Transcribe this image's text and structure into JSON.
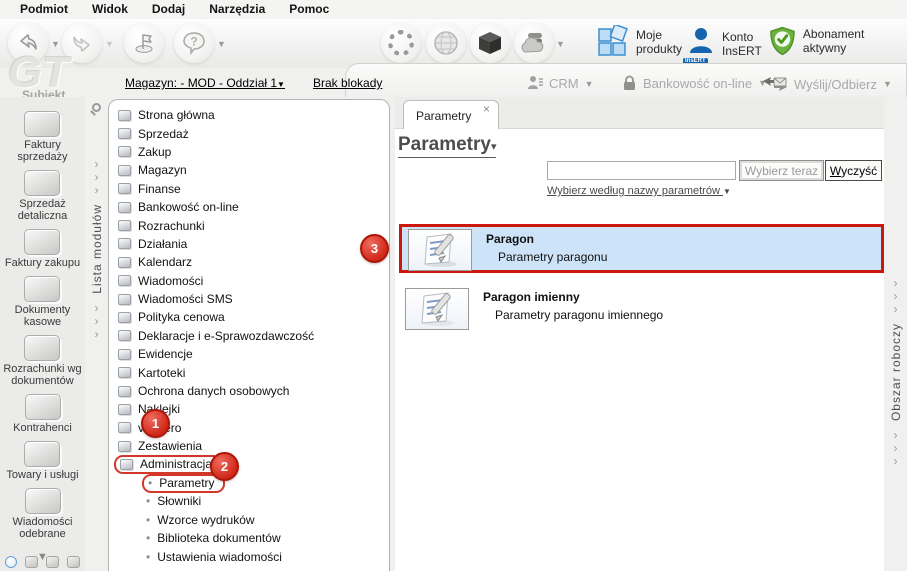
{
  "menubar": {
    "items": [
      "Podmiot",
      "Widok",
      "Dodaj",
      "Narzędzia",
      "Pomoc"
    ]
  },
  "toolbar": {
    "nav_icons": [
      "back-arrow-icon",
      "forward-arrow-icon",
      "flag-icon",
      "question-bubble-icon"
    ],
    "right_icons": [
      "spinner-icon",
      "globe-icon",
      "cube-icon",
      "cloud-server-icon"
    ],
    "moje_produkty": {
      "line1": "Moje",
      "line2": "produkty",
      "icon": "blue-squares-icon"
    },
    "konto_insert": {
      "line1": "Konto",
      "line2": "InsERT",
      "icon": "insert-person-icon",
      "icon_text": "InsERT"
    },
    "abonament": {
      "label": "Abonament aktywny",
      "icon": "green-shield-check-icon"
    }
  },
  "statusbar": {
    "magazyn_link": "Magazyn: - MOD - Oddział 1",
    "magazyn_caret": "▼",
    "blokada_link": "Brak blokady",
    "crm": {
      "label": "CRM",
      "icon": "crm-person-icon"
    },
    "bankowosc": {
      "label": "Bankowość on-line",
      "icon": "padlock-icon"
    },
    "wyslij": {
      "label": "Wyślij/Odbierz",
      "icon": "send-receive-icon"
    }
  },
  "sidebar": {
    "logo": "GT",
    "app_name": "Subiekt",
    "modules": [
      {
        "label1": "Faktury",
        "label2": "sprzedaży",
        "icon": "coins-icon"
      },
      {
        "label1": "Sprzedaż",
        "label2": "detaliczna",
        "icon": "basket-icon"
      },
      {
        "label1": "Faktury zakupu",
        "label2": "",
        "icon": "boxes-icon"
      },
      {
        "label1": "Dokumenty",
        "label2": "kasowe",
        "icon": "cash-icon"
      },
      {
        "label1": "Rozrachunki wg",
        "label2": "dokumentów",
        "icon": "check-doc-icon"
      },
      {
        "label1": "Kontrahenci",
        "label2": "",
        "icon": "person-icon"
      },
      {
        "label1": "Towary i usługi",
        "label2": "",
        "icon": "handtruck-icon"
      },
      {
        "label1": "Wiadomości",
        "label2": "odebrane",
        "icon": "inbox-icon"
      }
    ],
    "more_icon": "chevron-down-icon",
    "bottom_icons": [
      "circle-icon",
      "coins-small-icon",
      "basket-small-icon",
      "box-small-icon"
    ]
  },
  "module_strip": {
    "title": "Lista modułów"
  },
  "workspace_strip": {
    "title": "Obszar roboczy"
  },
  "tree": {
    "items": [
      {
        "label": "Strona główna",
        "icon": "home-icon"
      },
      {
        "label": "Sprzedaż",
        "icon": "sales-icon"
      },
      {
        "label": "Zakup",
        "icon": "purchase-icon"
      },
      {
        "label": "Magazyn",
        "icon": "warehouse-icon"
      },
      {
        "label": "Finanse",
        "icon": "finance-icon"
      },
      {
        "label": "Bankowość on-line",
        "icon": "banking-icon"
      },
      {
        "label": "Rozrachunki",
        "icon": "settlements-icon"
      },
      {
        "label": "Działania",
        "icon": "actions-icon"
      },
      {
        "label": "Kalendarz",
        "icon": "calendar-icon"
      },
      {
        "label": "Wiadomości",
        "icon": "messages-icon"
      },
      {
        "label": "Wiadomości SMS",
        "icon": "sms-icon"
      },
      {
        "label": "Polityka cenowa",
        "icon": "pricing-icon"
      },
      {
        "label": "Deklaracje i e-Sprawozdawczość",
        "icon": "declarations-icon"
      },
      {
        "label": "Ewidencje",
        "icon": "records-icon"
      },
      {
        "label": "Kartoteki",
        "icon": "card-files-icon"
      },
      {
        "label": "Ochrona danych osobowych",
        "icon": "gdpr-icon"
      },
      {
        "label": "Naklejki",
        "icon": "labels-icon"
      },
      {
        "label": "vendero",
        "icon": "vendero-gear-icon"
      },
      {
        "label": "Zestawienia",
        "icon": "reports-icon"
      },
      {
        "label": "Administracja",
        "icon": "administration-icon"
      },
      {
        "label": "Parametry",
        "bullet": "•"
      },
      {
        "label": "Słowniki",
        "bullet": "•"
      },
      {
        "label": "Wzorce wydruków",
        "bullet": "•"
      },
      {
        "label": "Biblioteka dokumentów",
        "bullet": "•"
      },
      {
        "label": "Ustawienia wiadomości",
        "bullet": "•"
      }
    ]
  },
  "annotations": {
    "steps": [
      "1",
      "2",
      "3"
    ],
    "highlight_color": "#d02819"
  },
  "main": {
    "tab": {
      "label": "Parametry",
      "close": "×"
    },
    "title": "Parametry",
    "title_caret": "▾",
    "search": {
      "value": "",
      "button_primary": "Wybierz teraz",
      "button_secondary": "Wyczyść",
      "filter_link": "Wybierz według nazwy parametrów",
      "filter_caret": "▼"
    },
    "results": [
      {
        "title": "Paragon",
        "subtitle": "Parametry paragonu",
        "icon": "note-pencil-icon",
        "selected": true
      },
      {
        "title": "Paragon imienny",
        "subtitle": "Parametry paragonu imiennego",
        "icon": "note-pencil-icon",
        "selected": false
      }
    ],
    "selection_color": "#cde4f8"
  }
}
